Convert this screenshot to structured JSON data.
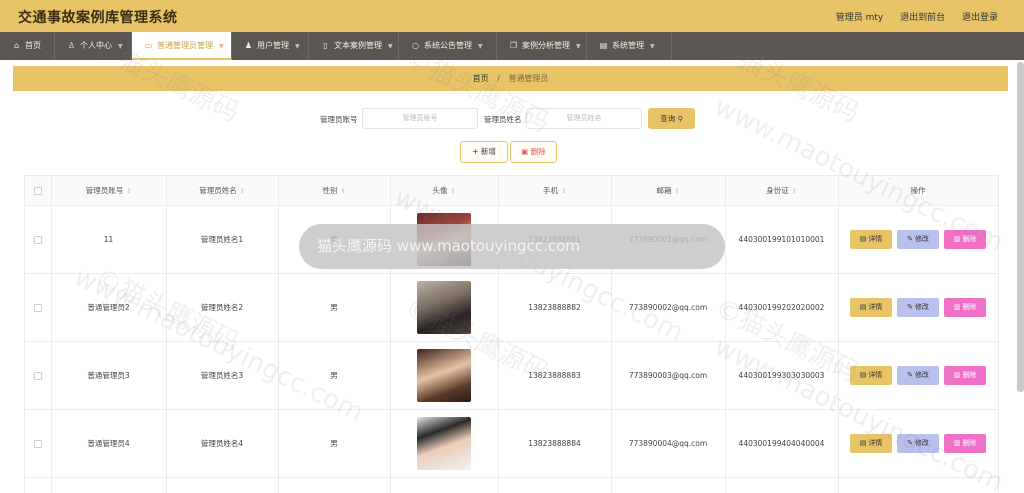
{
  "app": {
    "title": "交通事故案例库管理系统",
    "user_label": "管理员 mty",
    "back_label": "退出到前台",
    "logout_label": "退出登录"
  },
  "nav": [
    {
      "label": "首页",
      "icon": "home-icon",
      "glyph": "⌂",
      "chevron": false
    },
    {
      "label": "个人中心",
      "icon": "user-icon",
      "glyph": "♙",
      "chevron": true
    },
    {
      "label": "普通管理员管理",
      "icon": "chat-icon",
      "glyph": "▭",
      "chevron": true
    },
    {
      "label": "用户管理",
      "icon": "users-icon",
      "glyph": "♟",
      "chevron": true
    },
    {
      "label": "文本案例管理",
      "icon": "doc-icon",
      "glyph": "▯",
      "chevron": true
    },
    {
      "label": "系统公告管理",
      "icon": "clock-icon",
      "glyph": "○",
      "chevron": true
    },
    {
      "label": "案例分析管理",
      "icon": "copy-icon",
      "glyph": "❐",
      "chevron": true
    },
    {
      "label": "系统管理",
      "icon": "list-icon",
      "glyph": "▤",
      "chevron": true
    }
  ],
  "breadcrumb": {
    "home": "首页",
    "sep": "/",
    "current": "普通管理员"
  },
  "search": {
    "account_label": "管理员账号",
    "account_placeholder": "管理员账号",
    "name_label": "管理员姓名",
    "name_placeholder": "管理员姓名",
    "query_label": "查询"
  },
  "actions": {
    "add_label": "新增",
    "delete_label": "删除"
  },
  "table": {
    "headers": [
      "管理员账号",
      "管理员姓名",
      "性别",
      "头像",
      "手机",
      "邮箱",
      "身份证",
      "操作"
    ],
    "rows": [
      {
        "account": "11",
        "name": "管理员姓名1",
        "gender": "男",
        "phone": "13823888881",
        "email": "773890001@qq.com",
        "idcard": "440300199101010001"
      },
      {
        "account": "普通管理员2",
        "name": "管理员姓名2",
        "gender": "男",
        "phone": "13823888882",
        "email": "773890002@qq.com",
        "idcard": "440300199202020002"
      },
      {
        "account": "普通管理员3",
        "name": "管理员姓名3",
        "gender": "男",
        "phone": "13823888883",
        "email": "773890003@qq.com",
        "idcard": "440300199303030003"
      },
      {
        "account": "普通管理员4",
        "name": "管理员姓名4",
        "gender": "男",
        "phone": "13823888884",
        "email": "773890004@qq.com",
        "idcard": "440300199404040004"
      }
    ],
    "detail_label": "详情",
    "edit_label": "修改",
    "remove_label": "删除"
  },
  "watermark": {
    "text1": "©猫头鹰源码",
    "text2": "www.maotouyingcc.com",
    "pill": "猫头鹰源码 www.maotouyingcc.com"
  }
}
